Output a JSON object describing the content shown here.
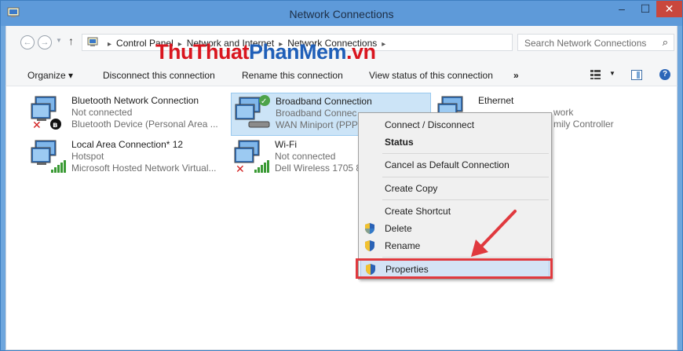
{
  "window": {
    "title": "Network Connections",
    "controls": {
      "minimize": "–",
      "maximize": "☐",
      "close": "✕"
    },
    "accent_color": "#5e9ad9"
  },
  "address": {
    "breadcrumbs": [
      "Control Panel",
      "Network and Internet",
      "Network Connections"
    ],
    "search_placeholder": "Search Network Connections"
  },
  "watermark": {
    "part1": "ThuThuat",
    "part2": "PhanMem",
    "part3": ".vn"
  },
  "toolbar": {
    "organize": "Organize ▾",
    "disconnect": "Disconnect this connection",
    "rename": "Rename this connection",
    "view_status": "View status of this connection",
    "more": "»",
    "help": "?"
  },
  "connections": [
    {
      "name": "Bluetooth Network Connection",
      "status": "Not connected",
      "device": "Bluetooth Device (Personal Area ...",
      "icon": "network-adapter-icon",
      "badge": "bluetooth-icon"
    },
    {
      "name": "Broadband Connection",
      "status": "Broadband Connec",
      "device": "WAN Miniport (PPP",
      "icon": "broadband-icon",
      "badge": "connected-check-icon",
      "selected": true
    },
    {
      "name": "Ethernet",
      "status": "work",
      "device": "mily Controller",
      "icon": "network-adapter-icon"
    },
    {
      "name": "Local Area Connection* 12",
      "status": "Hotspot",
      "device": "Microsoft Hosted Network Virtual...",
      "icon": "network-adapter-icon",
      "badge": "signal-icon"
    },
    {
      "name": "Wi-Fi",
      "status": "Not connected",
      "device": "Dell Wireless 1705 8",
      "icon": "network-adapter-icon",
      "badge": "signal-icon"
    }
  ],
  "context_menu": {
    "items": [
      {
        "label": "Connect / Disconnect"
      },
      {
        "label": "Status",
        "bold": true
      },
      {
        "label": "Cancel as Default Connection"
      },
      {
        "label": "Create Copy"
      },
      {
        "label": "Create Shortcut"
      },
      {
        "label": "Delete",
        "icon": "uac-shield-icon"
      },
      {
        "label": "Rename",
        "icon": "uac-shield-icon"
      },
      {
        "label": "Properties",
        "icon": "uac-shield-icon",
        "highlighted": true
      }
    ]
  },
  "annotation_color": "#e0393e"
}
